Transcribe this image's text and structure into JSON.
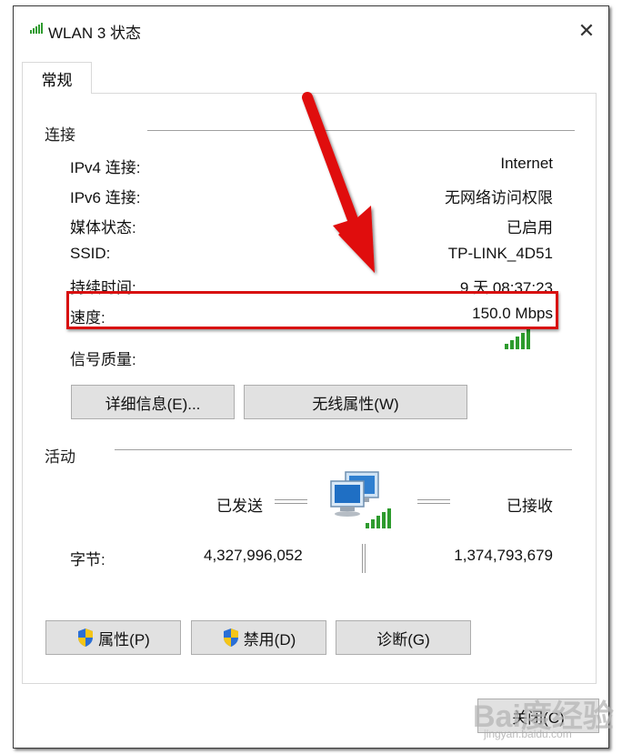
{
  "window": {
    "title": "WLAN 3 状态",
    "close_glyph": "✕"
  },
  "tabs": [
    {
      "label": "常规"
    }
  ],
  "connection": {
    "group_label": "连接",
    "rows": [
      {
        "label": "IPv4 连接:",
        "value": "Internet"
      },
      {
        "label": "IPv6 连接:",
        "value": "无网络访问权限"
      },
      {
        "label": "媒体状态:",
        "value": "已启用"
      },
      {
        "label": "SSID:",
        "value": "TP-LINK_4D51"
      },
      {
        "label": "持续时间:",
        "value": "9 天 08:37:23"
      },
      {
        "label": "速度:",
        "value": "150.0 Mbps"
      }
    ],
    "signal_label": "信号质量:",
    "signal_bars": 5,
    "buttons": {
      "details": "详细信息(E)...",
      "wireless_props": "无线属性(W)"
    }
  },
  "activity": {
    "group_label": "活动",
    "sent_label": "已发送",
    "received_label": "已接收",
    "bytes_label": "字节:",
    "bytes_sent": "4,327,996,052",
    "bytes_received": "1,374,793,679"
  },
  "bottom_buttons": {
    "properties": "属性(P)",
    "disable": "禁用(D)",
    "diagnose": "诊断(G)"
  },
  "close_button": "关闭(C)",
  "watermark": {
    "main": "Bai度经验",
    "sub": "jingyan.baidu.com"
  },
  "colors": {
    "annotation_red": "#d81010",
    "signal_green": "#2e9b2e"
  }
}
